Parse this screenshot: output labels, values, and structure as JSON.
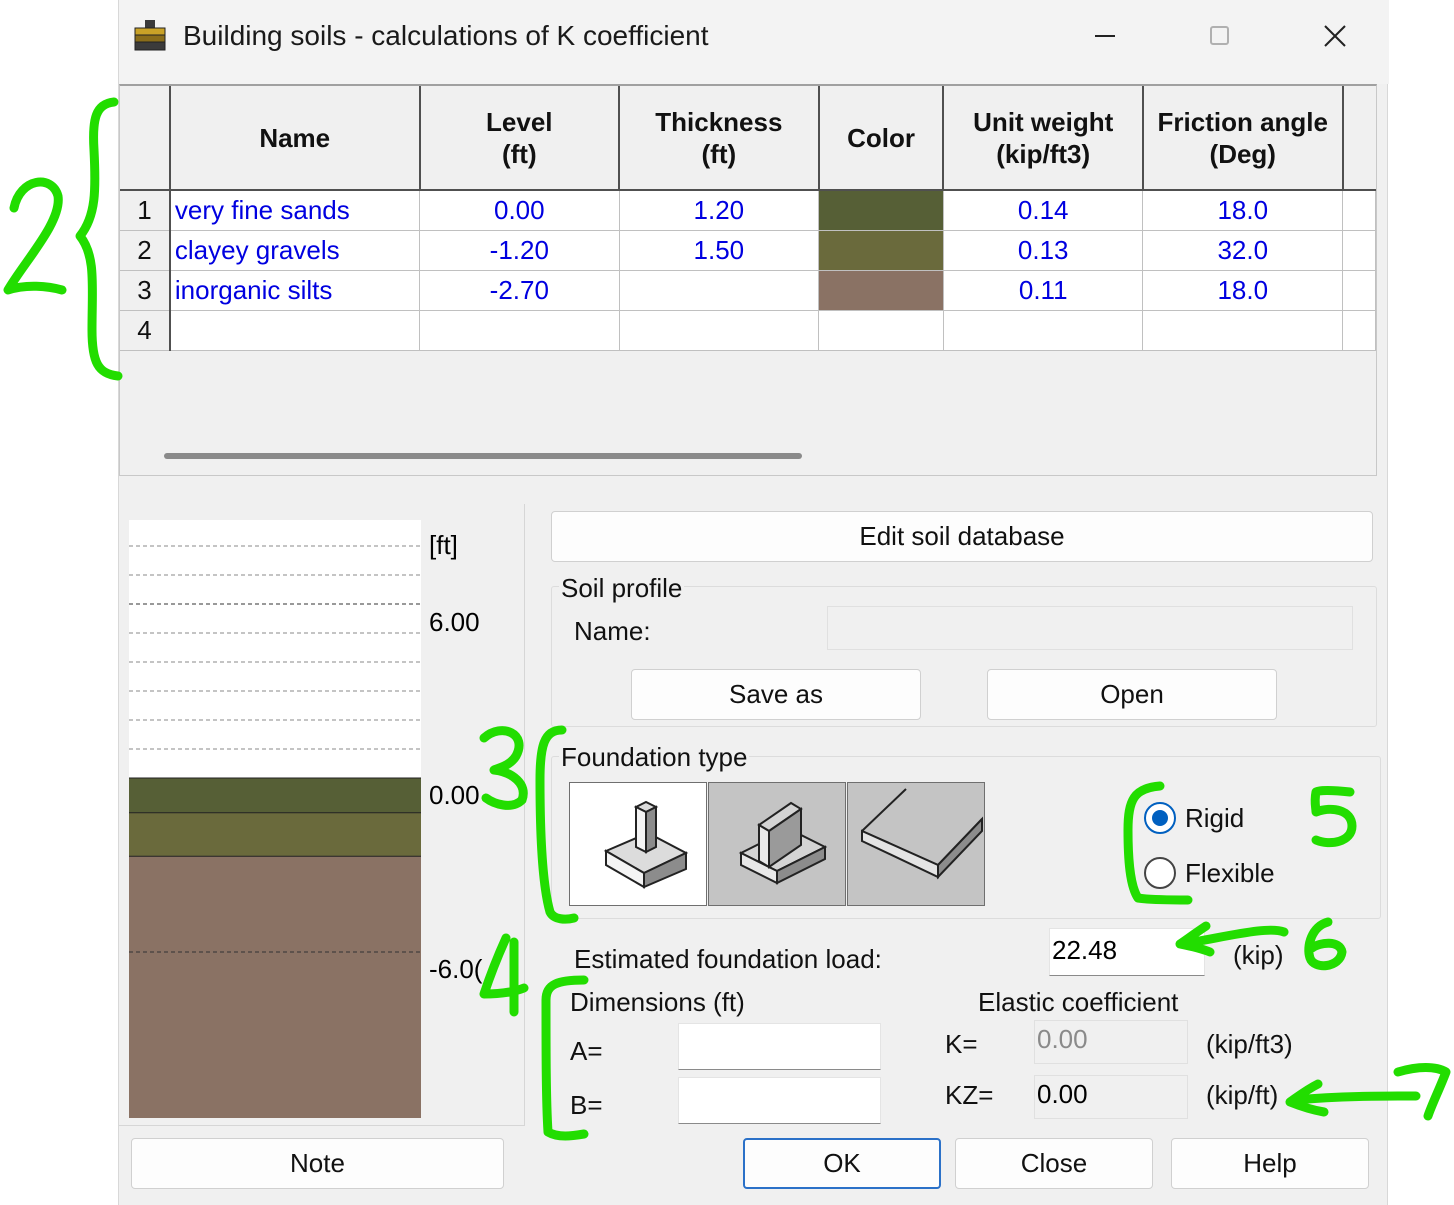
{
  "window": {
    "title": "Building soils - calculations of K coefficient",
    "icon": "stacked-layers-icon"
  },
  "grid": {
    "headers": [
      {
        "line1": "",
        "line2": ""
      },
      {
        "line1": "Name",
        "line2": ""
      },
      {
        "line1": "Level",
        "line2": "(ft)"
      },
      {
        "line1": "Thickness",
        "line2": "(ft)"
      },
      {
        "line1": "Color",
        "line2": ""
      },
      {
        "line1": "Unit weight",
        "line2": "(kip/ft3)"
      },
      {
        "line1": "Friction angle",
        "line2": "(Deg)"
      }
    ],
    "rows": [
      {
        "num": "1",
        "name": "very fine sands",
        "level": "0.00",
        "thickness": "1.20",
        "color": "#565f36",
        "unit_weight": "0.14",
        "friction": "18.0"
      },
      {
        "num": "2",
        "name": "clayey gravels",
        "level": "-1.20",
        "thickness": "1.50",
        "color": "#6a6a3c",
        "unit_weight": "0.13",
        "friction": "32.0"
      },
      {
        "num": "3",
        "name": "inorganic silts",
        "level": "-2.70",
        "thickness": "",
        "color": "#8a7264",
        "unit_weight": "0.11",
        "friction": "18.0"
      },
      {
        "num": "4",
        "name": "",
        "level": "",
        "thickness": "",
        "color": "",
        "unit_weight": "",
        "friction": ""
      }
    ]
  },
  "profile": {
    "unit_label": "[ft]",
    "tick_labels": [
      "6.00",
      "0.00",
      "-6.0("
    ],
    "layers": [
      {
        "name": "very fine sands",
        "top": 0.0,
        "bottom": -1.2,
        "color": "#565f36"
      },
      {
        "name": "clayey gravels",
        "top": -1.2,
        "bottom": -2.7,
        "color": "#6a6a3c"
      },
      {
        "name": "inorganic silts",
        "top": -2.7,
        "bottom": -12.0,
        "color": "#8a7264"
      }
    ]
  },
  "buttons": {
    "edit_db": "Edit soil database",
    "save_as": "Save as",
    "open": "Open",
    "note": "Note",
    "ok": "OK",
    "close": "Close",
    "help": "Help"
  },
  "soil_profile": {
    "group_label": "Soil profile",
    "name_label": "Name:",
    "name_value": ""
  },
  "foundation": {
    "group_label": "Foundation type",
    "types": [
      {
        "name": "isolated-footing-icon",
        "selected": true
      },
      {
        "name": "strip-footing-icon",
        "selected": false
      },
      {
        "name": "slab-foundation-icon",
        "selected": false
      }
    ],
    "options": [
      {
        "label": "Rigid",
        "checked": true
      },
      {
        "label": "Flexible",
        "checked": false
      }
    ]
  },
  "load": {
    "label": "Estimated foundation load:",
    "value": "22.48",
    "unit": "(kip)"
  },
  "dimensions": {
    "label": "Dimensions (ft)",
    "a_label": "A=",
    "a_value": "",
    "b_label": "B=",
    "b_value": ""
  },
  "elastic": {
    "label": "Elastic coefficient",
    "k_label": "K=",
    "k_value": "0.00",
    "k_unit": "(kip/ft3)",
    "kz_label": "KZ=",
    "kz_value": "0.00",
    "kz_unit": "(kip/ft)"
  },
  "annotations": {
    "color": "#22dd00",
    "marks": [
      "2",
      "3",
      "4",
      "5",
      "6",
      "7"
    ]
  }
}
